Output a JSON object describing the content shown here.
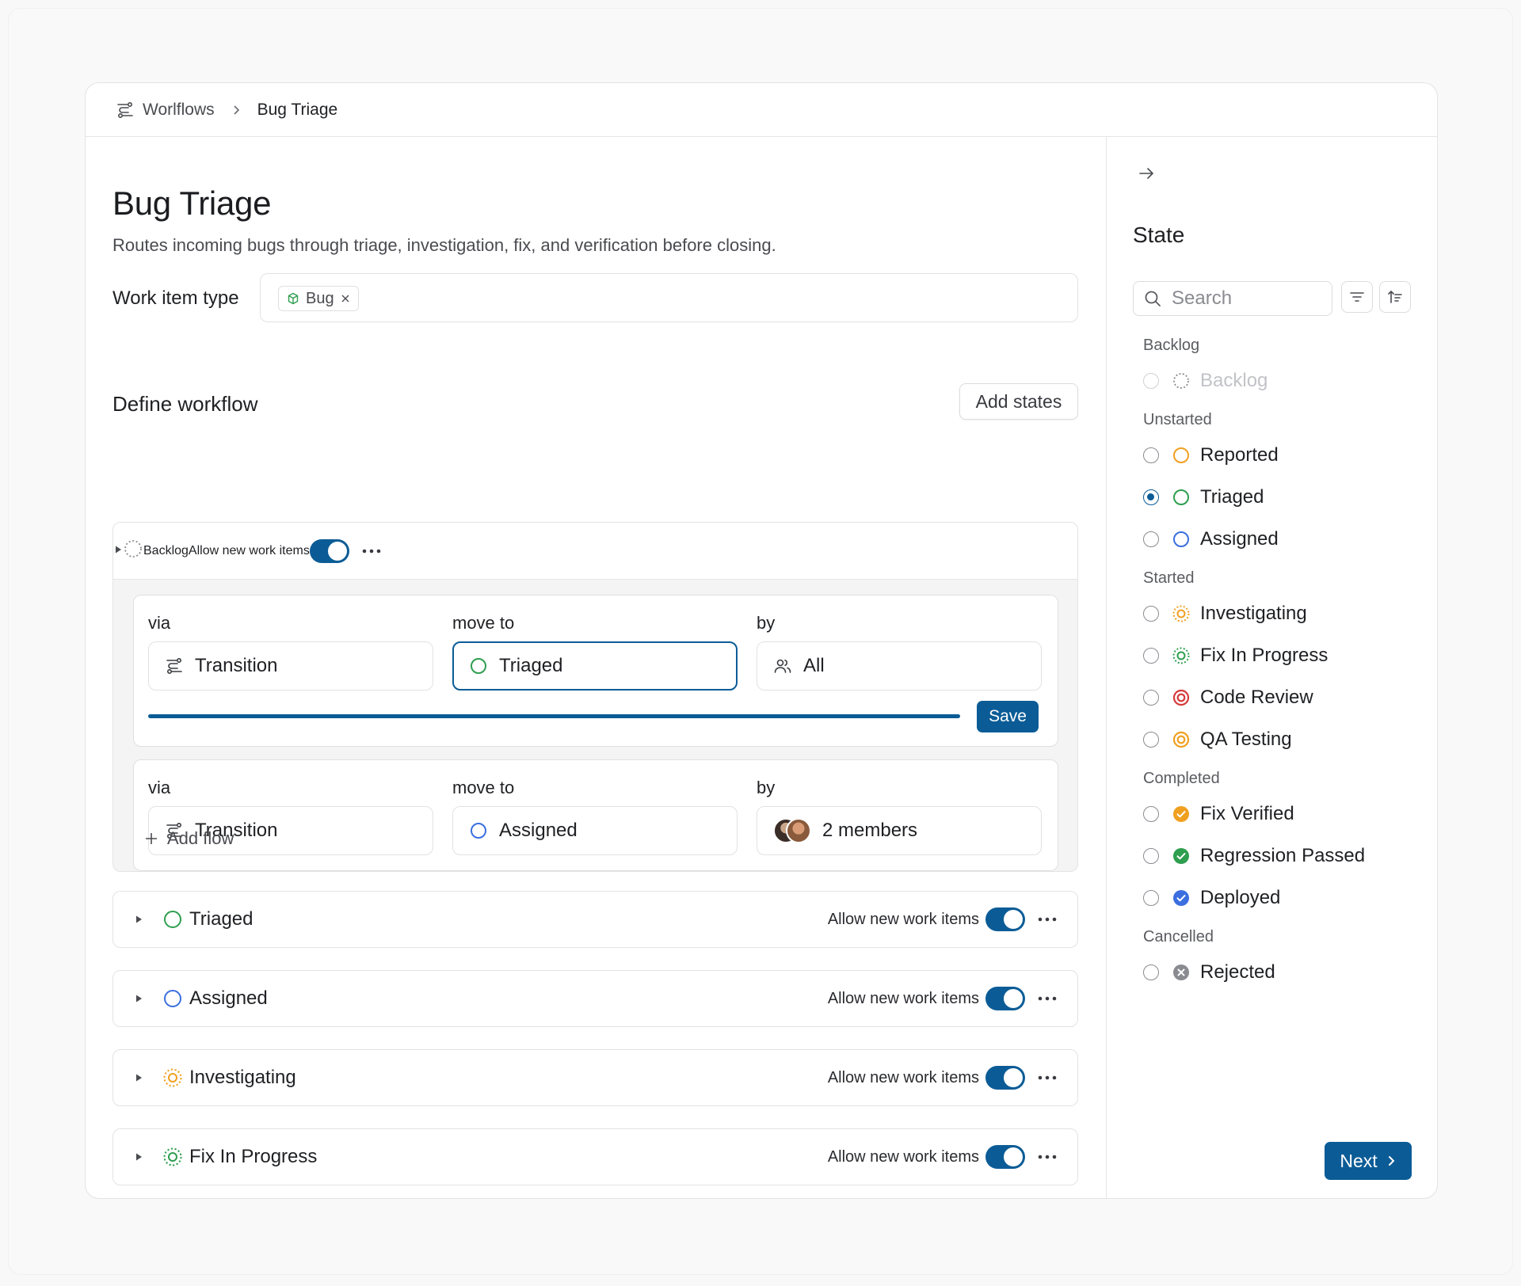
{
  "breadcrumb": {
    "parent": "Worlflows",
    "current": "Bug Triage"
  },
  "page": {
    "title": "Bug Triage",
    "description": "Routes incoming bugs through triage, investigation, fix, and verification before closing.",
    "work_item_type_label": "Work item type",
    "work_item_type_chip": "Bug"
  },
  "workflow": {
    "section_title": "Define workflow",
    "add_states_label": "Add states",
    "allow_label": "Allow new work items",
    "expanded_state": "Backlog",
    "flows": [
      {
        "via_label": "via",
        "move_label": "move to",
        "by_label": "by",
        "via": "Transition",
        "move_to": "Triaged",
        "by": "All",
        "save_label": "Save"
      },
      {
        "via_label": "via",
        "move_label": "move to",
        "by_label": "by",
        "via": "Transition",
        "move_to": "Assigned",
        "by": "2 members"
      }
    ],
    "add_flow_label": "Add flow",
    "states": [
      "Triaged",
      "Assigned",
      "Investigating",
      "Fix In Progress"
    ]
  },
  "side": {
    "title": "State",
    "search_placeholder": "Search",
    "groups": {
      "backlog": {
        "label": "Backlog",
        "options": [
          "Backlog"
        ]
      },
      "unstarted": {
        "label": "Unstarted",
        "options": [
          "Reported",
          "Triaged",
          "Assigned"
        ]
      },
      "started": {
        "label": "Started",
        "options": [
          "Investigating",
          "Fix In Progress",
          "Code Review",
          "QA Testing"
        ]
      },
      "completed": {
        "label": "Completed",
        "options": [
          "Fix Verified",
          "Regression Passed",
          "Deployed"
        ]
      },
      "cancelled": {
        "label": "Cancelled",
        "options": [
          "Rejected"
        ]
      }
    },
    "selected": "Triaged",
    "next_label": "Next"
  },
  "colors": {
    "primary": "#0b5c96",
    "green": "#2e9e4f",
    "blue": "#3b6fe0",
    "orange": "#f0a020",
    "red": "#d63a3a",
    "gray": "#8a8b90"
  }
}
